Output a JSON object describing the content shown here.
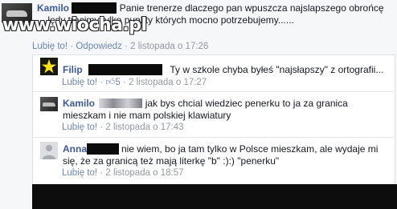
{
  "watermark": "www.wiocha.pl",
  "comments": [
    {
      "author": "Kamilo",
      "text": "Panie trenerze dlaczego pan wpuszcza najslapszego obrońcę ... lędy tracimy tylko punkty których mocno potrzebujemy......",
      "like": "Lubię to!",
      "reply": "Odpowiedz",
      "date": "2 listopada o 17:26"
    },
    {
      "author": "Filip",
      "text": "Ty w szkole chyba byłeś \"najsłapszy\" z ortografii...",
      "like": "Lubię to!",
      "likes_count": "5",
      "date": "2 listopada o 17:27"
    },
    {
      "author": "Kamilo",
      "text": "jak bys chcial wiedziec penerku to ja za granica mieszkam i nie mam polskiej klawiatury",
      "like": "Lubię to!",
      "date": "2 listopada o 17:43"
    },
    {
      "author": "Anna",
      "text": "nie wiem, bo ja tam tylko w Polsce mieszkam, ale wydaje mi się, że za granicą też mają literkę \"b\" :):) \"penerku\"",
      "like": "Lubię to!",
      "date": "2 listopada o 18:57"
    }
  ],
  "colors": {
    "link": "#3b5998",
    "meta": "#9197a3",
    "background": "#f6f7f9"
  }
}
